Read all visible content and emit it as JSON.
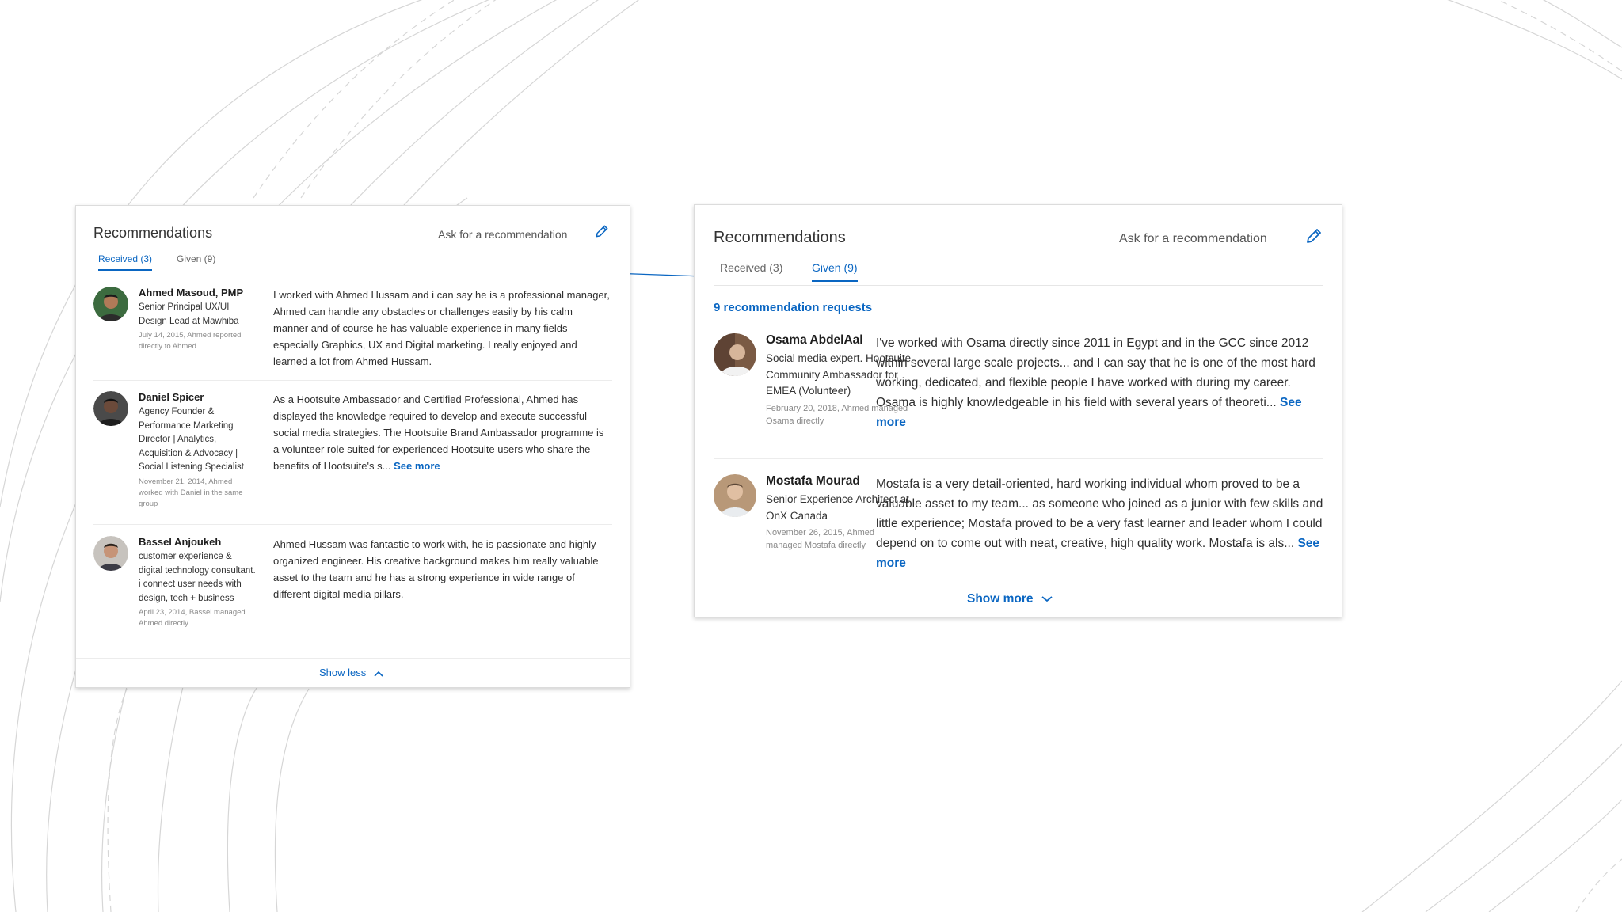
{
  "colors": {
    "accent": "#0a66c2",
    "card_border": "#dcdcdc"
  },
  "left_card": {
    "title": "Recommendations",
    "ask_label": "Ask for a recommendation",
    "edit_icon": "pencil-icon",
    "tabs": [
      {
        "label": "Received (3)",
        "active": true
      },
      {
        "label": "Given (9)",
        "active": false
      }
    ],
    "recommendations": [
      {
        "name": "Ahmed Masoud, PMP",
        "role": "Senior Principal UX/UI Design Lead at Mawhiba",
        "date": "July 14, 2015, Ahmed reported directly to Ahmed",
        "text": "I worked with Ahmed Hussam and i can say he is a professional manager, Ahmed can handle any obstacles or challenges easily by his calm manner and of course he has valuable experience in many fields especially Graphics, UX and Digital marketing. I really enjoyed and learned a lot from Ahmed Hussam.",
        "see_more": ""
      },
      {
        "name": "Daniel Spicer",
        "role": "Agency Founder & Performance Marketing Director | Analytics, Acquisition & Advocacy | Social Listening Specialist",
        "date": "November 21, 2014, Ahmed worked with Daniel in the same group",
        "text": "As a Hootsuite Ambassador and Certified Professional, Ahmed has displayed the knowledge required to develop and execute successful social media strategies. The Hootsuite Brand Ambassador programme is a volunteer role suited for experienced Hootsuite users who share the benefits of Hootsuite's s...",
        "see_more": "See more"
      },
      {
        "name": "Bassel Anjoukeh",
        "role": "customer experience & digital technology consultant. i connect user needs with design, tech + business",
        "date": "April 23, 2014, Bassel managed Ahmed directly",
        "text": "Ahmed Hussam was fantastic to work with, he is passionate and highly organized engineer. His creative background makes him really valuable asset to the team and he has a strong experience in wide range of different digital media pillars.",
        "see_more": ""
      }
    ],
    "show_label": "Show less"
  },
  "right_card": {
    "title": "Recommendations",
    "ask_label": "Ask for a recommendation",
    "edit_icon": "pencil-icon",
    "tabs": [
      {
        "label": "Received (3)",
        "active": false
      },
      {
        "label": "Given (9)",
        "active": true
      }
    ],
    "requests_label": "9 recommendation requests",
    "recommendations": [
      {
        "name": "Osama AbdelAal",
        "role": "Social media expert. Hootsuite Community Ambassador for EMEA (Volunteer)",
        "date": "February 20, 2018, Ahmed managed Osama directly",
        "text": "I've worked with Osama directly since 2011 in Egypt and in the GCC since 2012 within several large scale projects... and I can say that he is one of the most hard working, dedicated, and flexible people I have worked with during my career. Osama is highly knowledgeable in his field with several years of theoreti...",
        "see_more": "See more"
      },
      {
        "name": "Mostafa Mourad",
        "role": "Senior Experience Architect at OnX Canada",
        "date": "November 26, 2015, Ahmed managed Mostafa directly",
        "text": "Mostafa is a very detail-oriented, hard working individual whom proved to be a valuable asset to my team... as someone who joined as a junior with few skills and little experience; Mostafa proved to be a very fast learner and leader whom I could depend on to come out with neat, creative, high quality work. Mostafa is als...",
        "see_more": "See more"
      }
    ],
    "show_label": "Show more"
  }
}
